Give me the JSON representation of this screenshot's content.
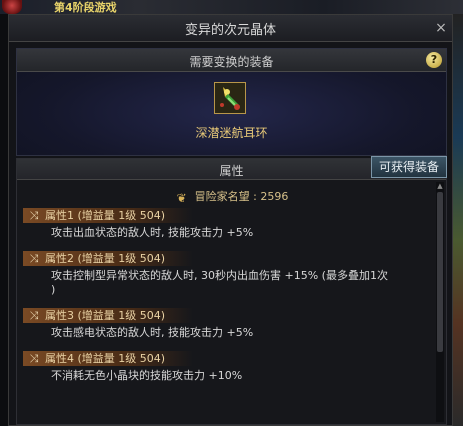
{
  "background": {
    "top_text": "第4阶段游戏"
  },
  "window": {
    "title": "变异的次元晶体",
    "close_symbol": "×"
  },
  "equipment": {
    "header": "需要变换的装备",
    "help_symbol": "?",
    "item_name": "深潜迷航耳环"
  },
  "attributes": {
    "header": "属性",
    "obtain_button": "可获得装备",
    "fame_label": "冒险家名望 : 2596",
    "options": [
      {
        "name": "属性1 (增益量 1级 504)",
        "lines": [
          "攻击出血状态的敌人时, 技能攻击力 +5%"
        ]
      },
      {
        "name": "属性2 (增益量 1级 504)",
        "lines": [
          "攻击控制型异常状态的敌人时, 30秒内出血伤害 +15% (最多叠加1次",
          ")"
        ]
      },
      {
        "name": "属性3 (增益量 1级 504)",
        "lines": [
          "攻击感电状态的敌人时, 技能攻击力 +5%"
        ]
      },
      {
        "name": "属性4 (增益量 1级 504)",
        "lines": [
          "不消耗无色小晶块的技能攻击力 +10%"
        ]
      }
    ]
  },
  "colors": {
    "item_name": "#e8c978",
    "button_border": "#7c96a8",
    "option_bar": "#7a4a24"
  }
}
